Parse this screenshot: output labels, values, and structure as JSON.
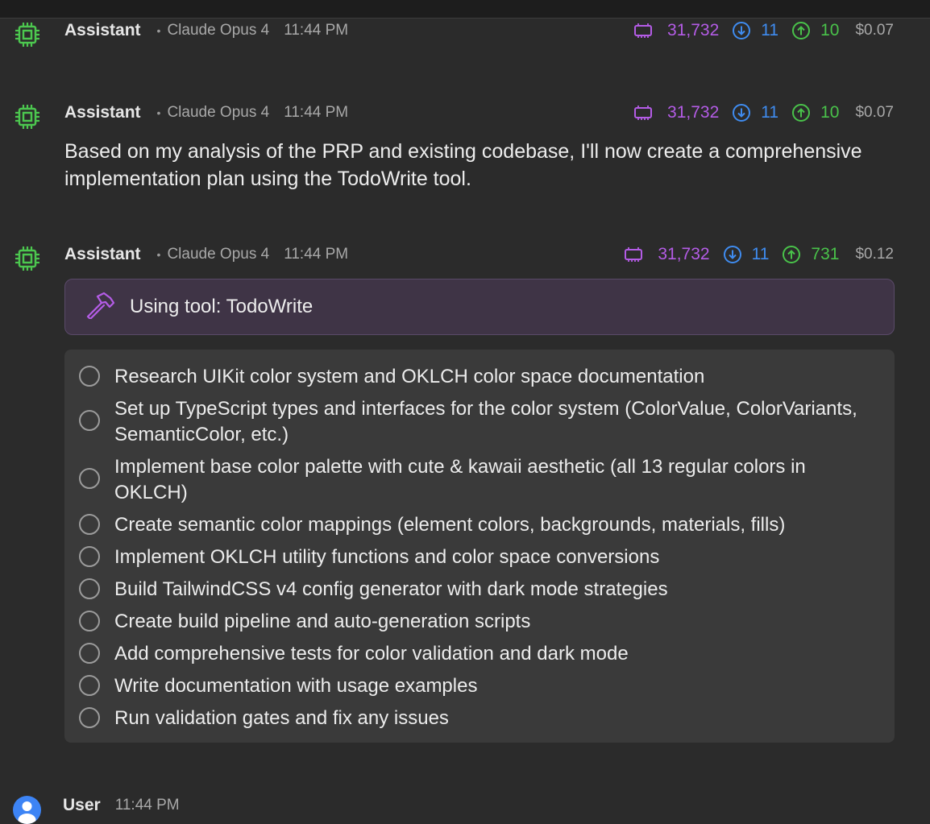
{
  "messages": [
    {
      "author": "Assistant",
      "model": "Claude Opus 4",
      "time": "11:44 PM",
      "stats": {
        "tokens": "31,732",
        "down": "11",
        "up": "10",
        "cost": "$0.07"
      }
    },
    {
      "author": "Assistant",
      "model": "Claude Opus 4",
      "time": "11:44 PM",
      "stats": {
        "tokens": "31,732",
        "down": "11",
        "up": "10",
        "cost": "$0.07"
      },
      "text": "Based on my analysis of the PRP and existing codebase, I'll now create a comprehensive implementation plan using the TodoWrite tool."
    },
    {
      "author": "Assistant",
      "model": "Claude Opus 4",
      "time": "11:44 PM",
      "stats": {
        "tokens": "31,732",
        "down": "11",
        "up": "731",
        "cost": "$0.12"
      },
      "tool": "Using tool: TodoWrite",
      "todos": [
        "Research UIKit color system and OKLCH color space documentation",
        "Set up TypeScript types and interfaces for the color system (ColorValue, ColorVariants, SemanticColor, etc.)",
        "Implement base color palette with cute & kawaii aesthetic (all 13 regular colors in OKLCH)",
        "Create semantic color mappings (element colors, backgrounds, materials, fills)",
        "Implement OKLCH utility functions and color space conversions",
        "Build TailwindCSS v4 config generator with dark mode strategies",
        "Create build pipeline and auto-generation scripts",
        "Add comprehensive tests for color validation and dark mode",
        "Write documentation with usage examples",
        "Run validation gates and fix any issues"
      ]
    },
    {
      "author": "User",
      "time": "11:44 PM"
    }
  ],
  "colors": {
    "tokens": "#b45ce6",
    "down": "#3f8cf0",
    "up": "#49c24a",
    "chip": "#4cc74f",
    "tool_accent": "#b45ce6"
  },
  "icons": {
    "assistant_avatar": "cpu-chip-icon",
    "user_avatar": "person-icon",
    "tokens": "memory-chip-icon",
    "down": "arrow-down-circle-icon",
    "up": "arrow-up-circle-icon",
    "tool": "hammer-icon",
    "todo": "empty-circle-icon"
  }
}
